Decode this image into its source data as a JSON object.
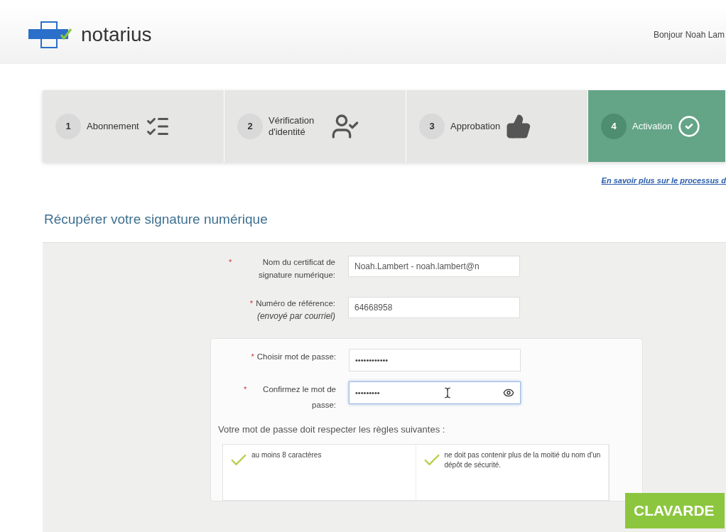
{
  "header": {
    "logo_text": "notarius",
    "greeting": "Bonjour Noah Lam"
  },
  "steps": [
    {
      "number": "1",
      "label": "Abonnement",
      "kind": "list",
      "selected": false
    },
    {
      "number": "2",
      "label": "Vérification d'identité",
      "kind": "user",
      "selected": false
    },
    {
      "number": "3",
      "label": "Approbation",
      "kind": "thumb",
      "selected": false
    },
    {
      "number": "4",
      "label": "Activation",
      "kind": "circle",
      "selected": true
    }
  ],
  "process_link": "En savoir plus sur le processus d",
  "heading": "Récupérer votre signature numérique",
  "fields": [
    {
      "marker": "*",
      "label": "Nom du certificat de signature numérique:",
      "value": "Noah.Lambert - noah.lambert@n"
    },
    {
      "marker": "*",
      "label": "Numéro de référence:",
      "note": "(envoyé par courriel)",
      "value": "64668958"
    }
  ],
  "password_fields": [
    {
      "marker": "*",
      "label": "Choisir mot de passe:",
      "value": "••••••••••••",
      "focused": false
    },
    {
      "marker": "*",
      "label": "Confirmez le mot de passe:",
      "value": "•••••••••",
      "focused": true
    }
  ],
  "rules_title": "Votre mot de passe doit respecter les règles suivantes :",
  "rules": [
    {
      "text": "au moins 8 caractères",
      "met": true
    },
    {
      "text": "ne doit pas contenir plus de la moitié du nom d'un dépôt de sécurité.",
      "met": true
    }
  ],
  "chat_button": "CLAVARDE"
}
